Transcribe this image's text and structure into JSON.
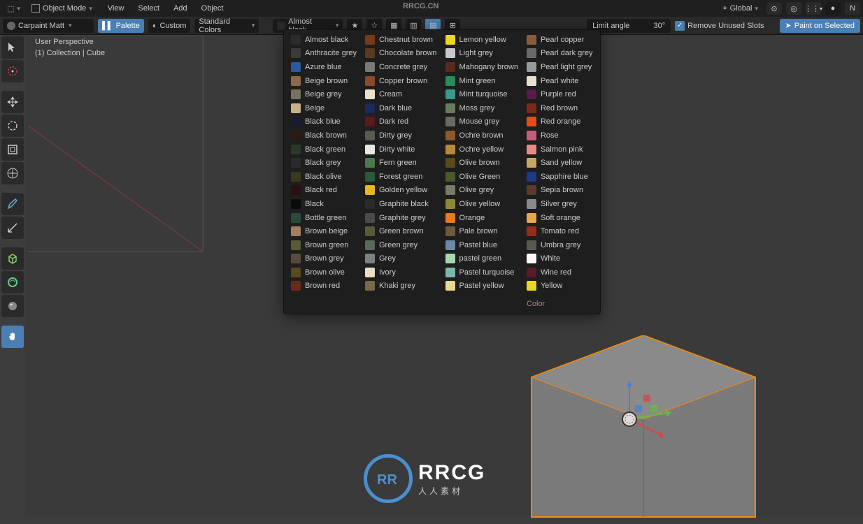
{
  "top_menu": {
    "mode_label": "Object Mode",
    "items": [
      "View",
      "Select",
      "Add",
      "Object"
    ],
    "orientation_label": "Global"
  },
  "toolbar": {
    "material_name": "Carpaint Matt",
    "palette_btn": "Palette",
    "custom_btn": "Custom",
    "color_set_label": "Standard Colors",
    "selected_color": "Almost black",
    "limit_angle_label": "Limit angle",
    "limit_angle_value": "30°",
    "remove_unused_label": "Remove Unused Slots",
    "paint_btn": "Paint on Selected"
  },
  "viewport": {
    "line1": "User Perspective",
    "line2": "(1) Collection | Cube"
  },
  "palette": {
    "footer": "Color",
    "columns": [
      [
        {
          "c": "#2a2a2d",
          "n": "Almost black"
        },
        {
          "c": "#3b3b3b",
          "n": "Anthracite grey"
        },
        {
          "c": "#2a5aa0",
          "n": "Azure blue"
        },
        {
          "c": "#8a6a4a",
          "n": "Beige brown"
        },
        {
          "c": "#7a7060",
          "n": "Beige grey"
        },
        {
          "c": "#c8b088",
          "n": "Beige"
        },
        {
          "c": "#1a1a30",
          "n": "Black blue"
        },
        {
          "c": "#2a1a10",
          "n": "Black brown"
        },
        {
          "c": "#2a3a2a",
          "n": "Black green"
        },
        {
          "c": "#2a2a2a",
          "n": "Black grey"
        },
        {
          "c": "#3a3a20",
          "n": "Black olive"
        },
        {
          "c": "#2a1010",
          "n": "Black red"
        },
        {
          "c": "#0a0a0a",
          "n": "Black"
        },
        {
          "c": "#2a4a3a",
          "n": "Bottle green"
        },
        {
          "c": "#a08060",
          "n": "Brown beige"
        },
        {
          "c": "#5a5a3a",
          "n": "Brown green"
        },
        {
          "c": "#5a4a3a",
          "n": "Brown grey"
        },
        {
          "c": "#5a4a20",
          "n": "Brown olive"
        },
        {
          "c": "#6a2a1a",
          "n": "Brown red"
        }
      ],
      [
        {
          "c": "#7a3a1a",
          "n": "Chestnut brown"
        },
        {
          "c": "#5a3a20",
          "n": "Chocolate brown"
        },
        {
          "c": "#7a7a7a",
          "n": "Concrete grey"
        },
        {
          "c": "#8a4a2a",
          "n": "Copper brown"
        },
        {
          "c": "#e8e0c8",
          "n": "Cream"
        },
        {
          "c": "#1a2a5a",
          "n": "Dark blue"
        },
        {
          "c": "#5a1a1a",
          "n": "Dark red"
        },
        {
          "c": "#5a5a50",
          "n": "Dirty grey"
        },
        {
          "c": "#e8e8e0",
          "n": "Dirty white"
        },
        {
          "c": "#4a7a4a",
          "n": "Fern green"
        },
        {
          "c": "#2a5a3a",
          "n": "Forest green"
        },
        {
          "c": "#e8b820",
          "n": "Golden yellow"
        },
        {
          "c": "#2a2a2a",
          "n": "Graphite black"
        },
        {
          "c": "#4a4a4a",
          "n": "Graphite grey"
        },
        {
          "c": "#5a5a3a",
          "n": "Green brown"
        },
        {
          "c": "#5a6a5a",
          "n": "Green grey"
        },
        {
          "c": "#808080",
          "n": "Grey"
        },
        {
          "c": "#e8e0c0",
          "n": "Ivory"
        },
        {
          "c": "#7a6a4a",
          "n": "Khaki grey"
        }
      ],
      [
        {
          "c": "#e8d820",
          "n": "Lemon yellow"
        },
        {
          "c": "#c8c8c8",
          "n": "Light grey"
        },
        {
          "c": "#5a2a1a",
          "n": "Mahogany brown"
        },
        {
          "c": "#2a8a5a",
          "n": "Mint green"
        },
        {
          "c": "#3a9a8a",
          "n": "Mint turquoise"
        },
        {
          "c": "#6a7a5a",
          "n": "Moss grey"
        },
        {
          "c": "#6a6a60",
          "n": "Mouse grey"
        },
        {
          "c": "#8a5a2a",
          "n": "Ochre brown"
        },
        {
          "c": "#b88a3a",
          "n": "Ochre yellow"
        },
        {
          "c": "#5a4a1a",
          "n": "Olive brown"
        },
        {
          "c": "#4a5a2a",
          "n": "Olive Green"
        },
        {
          "c": "#7a7a6a",
          "n": "Olive grey"
        },
        {
          "c": "#8a8a3a",
          "n": "Olive yellow"
        },
        {
          "c": "#e87a1a",
          "n": "Orange"
        },
        {
          "c": "#6a5a40",
          "n": "Pale brown"
        },
        {
          "c": "#6a8aa8",
          "n": "Pastel blue"
        },
        {
          "c": "#a8d8b0",
          "n": "pastel green"
        },
        {
          "c": "#7ab8b0",
          "n": "Pastel turquoise"
        },
        {
          "c": "#e8d890",
          "n": "Pastel yellow"
        }
      ],
      [
        {
          "c": "#8a5a3a",
          "n": "Pearl copper"
        },
        {
          "c": "#6a6a6a",
          "n": "Pearl dark grey"
        },
        {
          "c": "#9a9a9a",
          "n": "Pearl light grey"
        },
        {
          "c": "#e8e0d0",
          "n": "Pearl white"
        },
        {
          "c": "#5a1a4a",
          "n": "Purple red"
        },
        {
          "c": "#7a2a1a",
          "n": "Red brown"
        },
        {
          "c": "#e84a1a",
          "n": "Red orange"
        },
        {
          "c": "#c85a7a",
          "n": "Rose"
        },
        {
          "c": "#e88a8a",
          "n": "Salmon pink"
        },
        {
          "c": "#c8a860",
          "n": "Sand yellow"
        },
        {
          "c": "#1a3a8a",
          "n": "Sapphire blue"
        },
        {
          "c": "#5a3a2a",
          "n": "Sepia brown"
        },
        {
          "c": "#8a8a8a",
          "n": "Silver grey"
        },
        {
          "c": "#e8a84a",
          "n": "Soft orange"
        },
        {
          "c": "#9a2a1a",
          "n": "Tomato red"
        },
        {
          "c": "#5a5a50",
          "n": "Umbra grey"
        },
        {
          "c": "#f8f8f8",
          "n": "White"
        },
        {
          "c": "#5a1a2a",
          "n": "Wine red"
        },
        {
          "c": "#e8d820",
          "n": "Yellow"
        }
      ]
    ]
  },
  "watermark": {
    "top": "RRCG.CN",
    "logo_big": "RRCG",
    "logo_small": "人人素材"
  }
}
